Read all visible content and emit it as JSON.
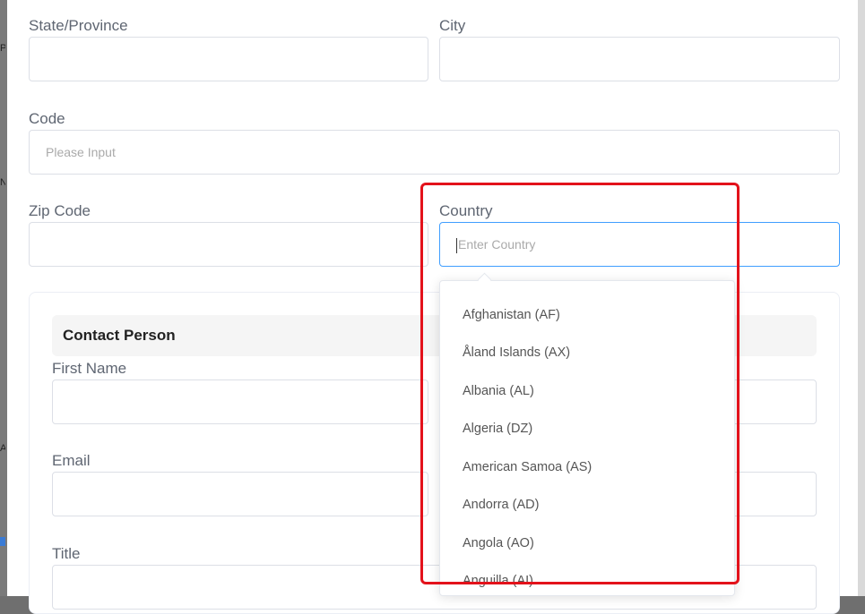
{
  "form": {
    "state": {
      "label": "State/Province",
      "value": ""
    },
    "city": {
      "label": "City",
      "value": ""
    },
    "code": {
      "label": "Code",
      "placeholder": "Please Input"
    },
    "zip": {
      "label": "Zip Code",
      "value": ""
    },
    "country": {
      "label": "Country",
      "placeholder": "Enter Country"
    }
  },
  "contact": {
    "title": "Contact Person",
    "first_name_label": "First Name",
    "email_label": "Email",
    "title_label": "Title"
  },
  "country_dropdown": {
    "options": [
      "Afghanistan (AF)",
      "Åland Islands (AX)",
      "Albania (AL)",
      "Algeria (DZ)",
      "American Samoa (AS)",
      "Andorra (AD)",
      "Angola (AO)",
      "Anguilla (AI)"
    ]
  },
  "edge_glyphs": [
    "P",
    "N",
    "A"
  ],
  "colors": {
    "focus_border": "#409eff",
    "highlight": "#e3121b"
  }
}
